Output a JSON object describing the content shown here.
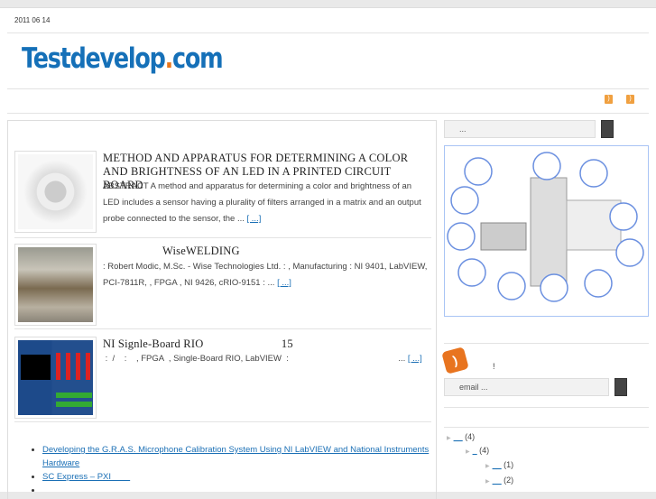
{
  "header": {
    "date": "2011 06 14",
    "logo_main": "Testdevelop",
    "logo_dot": ".",
    "logo_tld": "com"
  },
  "posts": [
    {
      "title": "METHOD AND APPARATUS FOR DETERMINING A COLOR AND BRIGHTNESS OF AN LED IN A PRINTED CIRCUIT BOARD",
      "excerpt": "ABSTRACT A method and apparatus for determining a color and brightness of an LED includes a sensor having a plurality of filters arranged in a matrix and an output probe connected to the sensor, the ... ",
      "more": "[ ...]"
    },
    {
      "title": "WiseWELDING",
      "excerpt": ": Robert Modic, M.Sc. - Wise Technologies Ltd.  :    , Manufacturing  : NI 9401, LabVIEW, PCI-7811R,      , FPGA  , NI 9426, cRIO-9151  :                                              ... ",
      "more": "[ ...]"
    },
    {
      "title": "NI Signle-Board RIO                          15",
      "excerpt": " :  /    :    , FPGA  , Single-Board RIO, LabVIEW  :                                              ... ",
      "more": "[ ...]"
    }
  ],
  "links": [
    "Developing the G.R.A.S. Microphone Calibration System Using NI LabVIEW and National Instruments Hardware",
    "SC Express – PXI        ",
    ""
  ],
  "sidebar": {
    "search_placeholder": "...",
    "subscribe_text": "!",
    "email_placeholder": "email ...",
    "tree": [
      {
        "label": "__",
        "count": "(4)"
      },
      {
        "label": "_",
        "count": "(4)"
      },
      {
        "label": "__",
        "count": "(1)"
      },
      {
        "label": "__",
        "count": "(2)"
      }
    ]
  },
  "colors": {
    "brand": "#1570b8",
    "accent": "#e8751a",
    "link": "#1a6fb5"
  }
}
